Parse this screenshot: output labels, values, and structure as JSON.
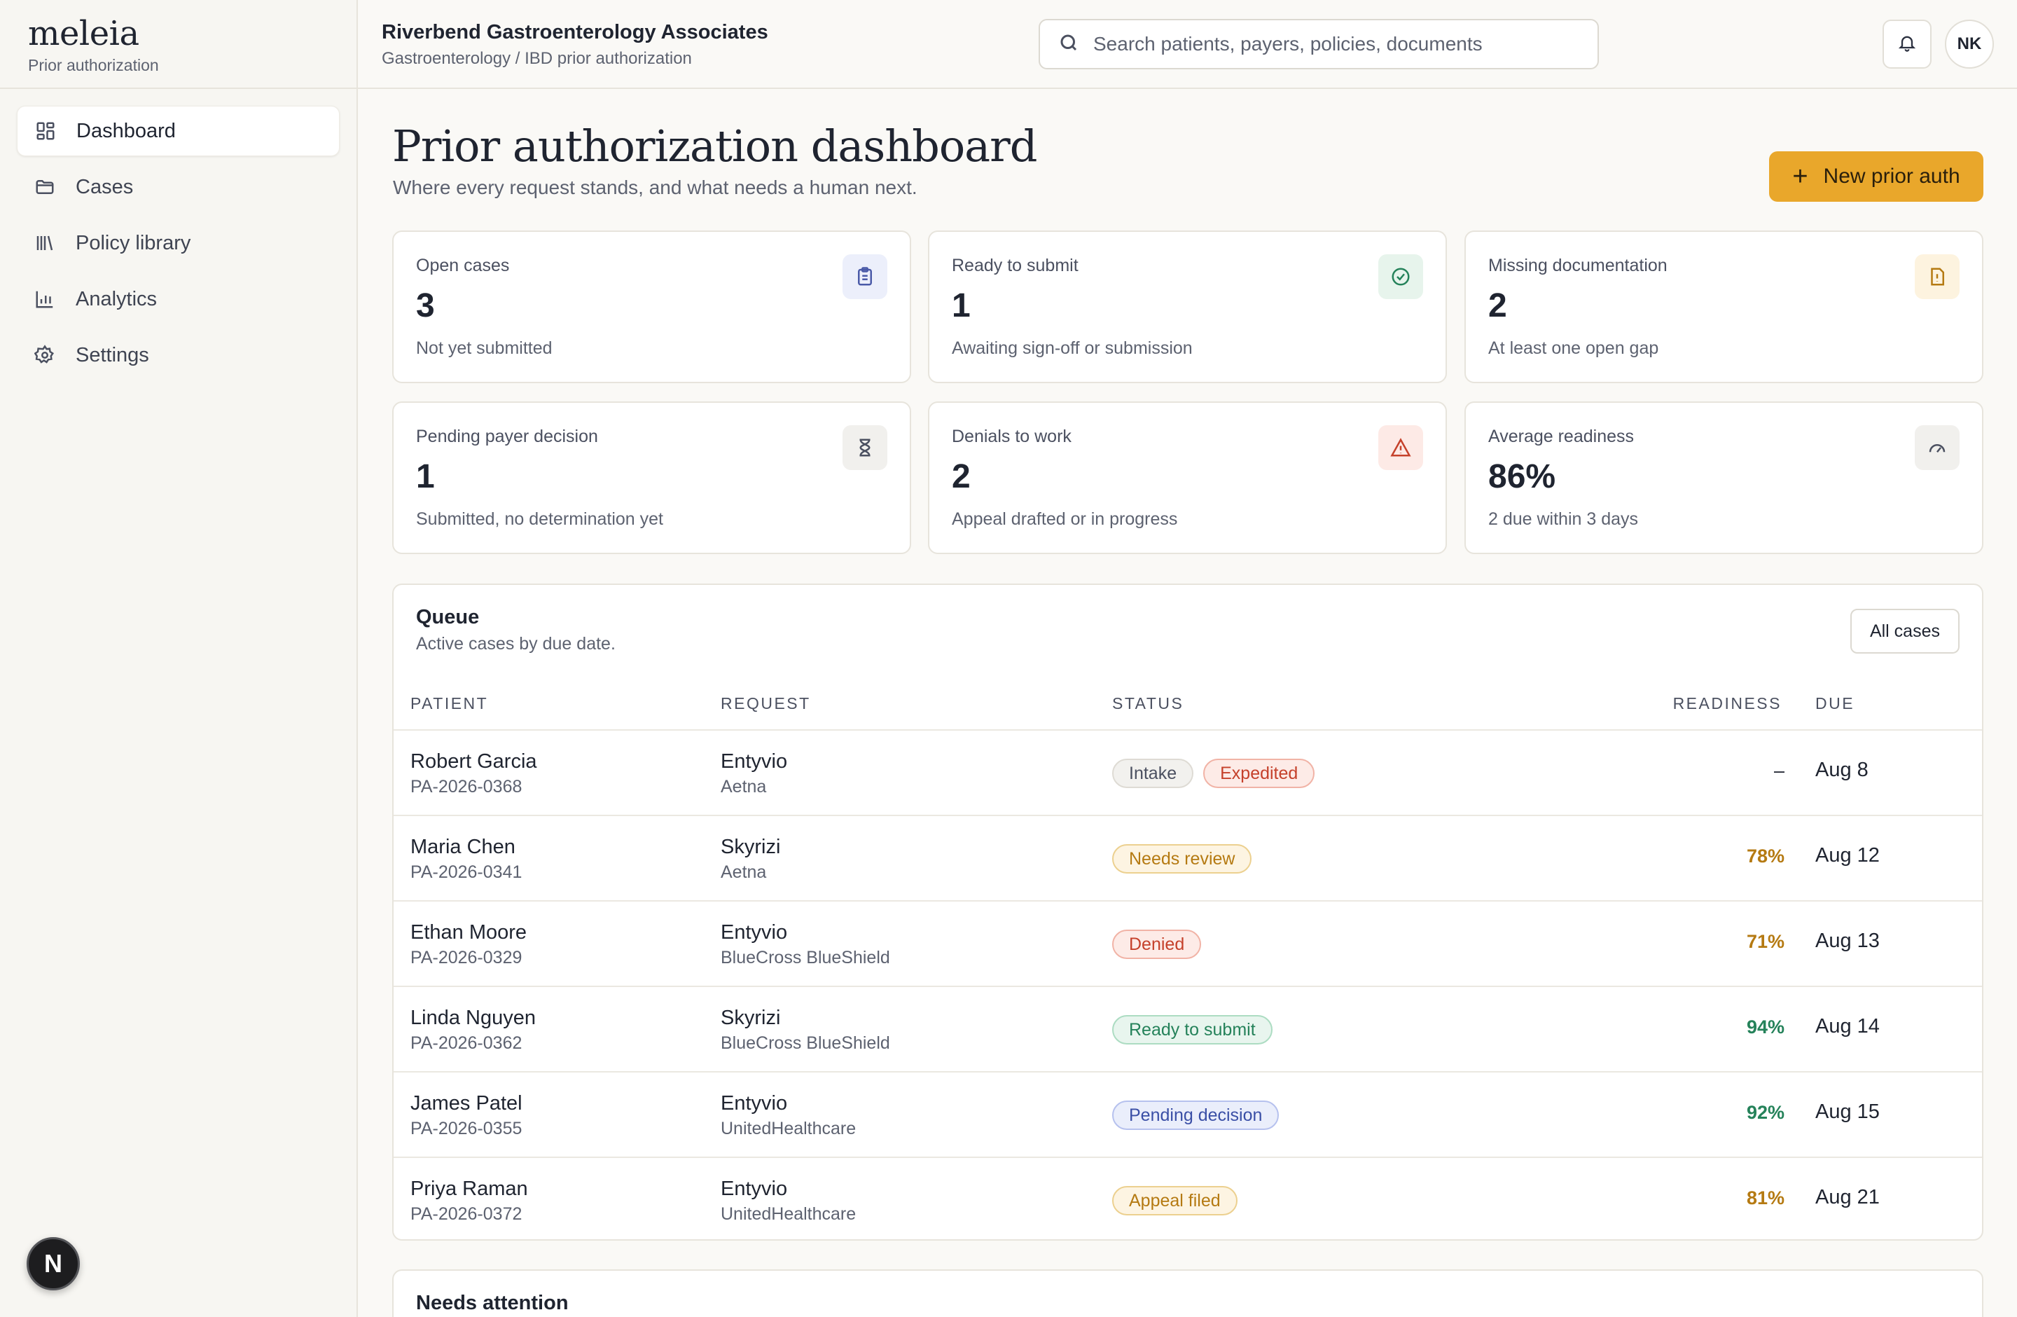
{
  "brand": {
    "name": "meleia",
    "subtitle": "Prior authorization"
  },
  "nav": [
    {
      "label": "Dashboard",
      "icon": "dashboard-grid-icon",
      "active": true
    },
    {
      "label": "Cases",
      "icon": "folder-icon"
    },
    {
      "label": "Policy library",
      "icon": "library-icon"
    },
    {
      "label": "Analytics",
      "icon": "bar-chart-icon"
    },
    {
      "label": "Settings",
      "icon": "gear-icon"
    }
  ],
  "header": {
    "org_name": "Riverbend Gastroenterology Associates",
    "org_sub": "Gastroenterology / IBD prior authorization",
    "search_placeholder": "Search patients, payers, policies, documents",
    "avatar_initials": "NK"
  },
  "page": {
    "title": "Prior authorization dashboard",
    "subtitle": "Where every request stands, and what needs a human next.",
    "new_button": "New prior auth"
  },
  "stats": [
    {
      "label": "Open cases",
      "value": "3",
      "note": "Not yet submitted",
      "icon": "clipboard-icon"
    },
    {
      "label": "Ready to submit",
      "value": "1",
      "note": "Awaiting sign-off or submission",
      "icon": "check-circle-icon"
    },
    {
      "label": "Missing documentation",
      "value": "2",
      "note": "At least one open gap",
      "icon": "document-alert-icon"
    },
    {
      "label": "Pending payer decision",
      "value": "1",
      "note": "Submitted, no determination yet",
      "icon": "hourglass-icon"
    },
    {
      "label": "Denials to work",
      "value": "2",
      "note": "Appeal drafted or in progress",
      "icon": "warning-triangle-icon"
    },
    {
      "label": "Average readiness",
      "value": "86%",
      "note": "2 due within 3 days",
      "icon": "gauge-icon"
    }
  ],
  "queue": {
    "title": "Queue",
    "subtitle": "Active cases by due date.",
    "all_button": "All cases",
    "columns": {
      "patient": "PATIENT",
      "request": "REQUEST",
      "status": "STATUS",
      "readiness": "READINESS",
      "due": "DUE"
    },
    "rows": [
      {
        "name": "Robert Garcia",
        "id": "PA-2026-0368",
        "drug": "Entyvio",
        "payer": "Aetna",
        "statuses": [
          {
            "label": "Intake",
            "tone": "gray"
          },
          {
            "label": "Expedited",
            "tone": "red"
          }
        ],
        "readiness": "–",
        "due": "Aug 8"
      },
      {
        "name": "Maria Chen",
        "id": "PA-2026-0341",
        "drug": "Skyrizi",
        "payer": "Aetna",
        "statuses": [
          {
            "label": "Needs review",
            "tone": "amber"
          }
        ],
        "readiness": "78%",
        "due": "Aug 12"
      },
      {
        "name": "Ethan Moore",
        "id": "PA-2026-0329",
        "drug": "Entyvio",
        "payer": "BlueCross BlueShield",
        "statuses": [
          {
            "label": "Denied",
            "tone": "red"
          }
        ],
        "readiness": "71%",
        "due": "Aug 13"
      },
      {
        "name": "Linda Nguyen",
        "id": "PA-2026-0362",
        "drug": "Skyrizi",
        "payer": "BlueCross BlueShield",
        "statuses": [
          {
            "label": "Ready to submit",
            "tone": "green"
          }
        ],
        "readiness": "94%",
        "due": "Aug 14"
      },
      {
        "name": "James Patel",
        "id": "PA-2026-0355",
        "drug": "Entyvio",
        "payer": "UnitedHealthcare",
        "statuses": [
          {
            "label": "Pending decision",
            "tone": "blue"
          }
        ],
        "readiness": "92%",
        "due": "Aug 15"
      },
      {
        "name": "Priya Raman",
        "id": "PA-2026-0372",
        "drug": "Entyvio",
        "payer": "UnitedHealthcare",
        "statuses": [
          {
            "label": "Appeal filed",
            "tone": "amber"
          }
        ],
        "readiness": "81%",
        "due": "Aug 21"
      }
    ]
  },
  "attention": {
    "title": "Needs attention"
  },
  "corner_badge": "N",
  "colors": {
    "accent": "#e9a72b",
    "amber": "#b57a12",
    "green": "#25825a",
    "red": "#c5412b",
    "blue": "#3a4fa6"
  }
}
